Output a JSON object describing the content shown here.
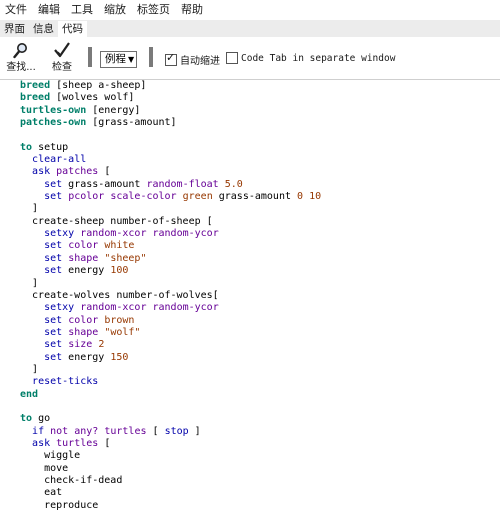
{
  "menu": [
    "文件",
    "编辑",
    "工具",
    "缩放",
    "标签页",
    "帮助"
  ],
  "tabs": [
    {
      "label": "界面",
      "active": false
    },
    {
      "label": "信息",
      "active": false
    },
    {
      "label": "代码",
      "active": true
    }
  ],
  "toolbar": {
    "find_label": "查找...",
    "check_label": "检查",
    "procedures_label": "例程",
    "auto_indent_label": "自动缩进",
    "auto_indent_checked": true,
    "separate_window_label": "Code Tab in separate window",
    "separate_window_checked": false
  },
  "colors": {
    "keyword": "#007f69",
    "command": "#0000aa",
    "reporter": "#660096",
    "constant": "#963700"
  },
  "code_lines": [
    [
      {
        "t": "breed",
        "c": "kw"
      },
      {
        "t": " [sheep a-sheep]"
      }
    ],
    [
      {
        "t": "breed",
        "c": "kw"
      },
      {
        "t": " [wolves wolf]"
      }
    ],
    [
      {
        "t": "turtles-own",
        "c": "kw"
      },
      {
        "t": " [energy]"
      }
    ],
    [
      {
        "t": "patches-own",
        "c": "kw"
      },
      {
        "t": " [grass-amount]"
      }
    ],
    [],
    [
      {
        "t": "to",
        "c": "kw"
      },
      {
        "t": " setup"
      }
    ],
    [
      {
        "t": "  "
      },
      {
        "t": "clear-all",
        "c": "cmd"
      }
    ],
    [
      {
        "t": "  "
      },
      {
        "t": "ask",
        "c": "cmd"
      },
      {
        "t": " "
      },
      {
        "t": "patches",
        "c": "rep"
      },
      {
        "t": " ["
      }
    ],
    [
      {
        "t": "    "
      },
      {
        "t": "set",
        "c": "cmd"
      },
      {
        "t": " grass-amount "
      },
      {
        "t": "random-float",
        "c": "rep"
      },
      {
        "t": " "
      },
      {
        "t": "5.0",
        "c": "con"
      }
    ],
    [
      {
        "t": "    "
      },
      {
        "t": "set",
        "c": "cmd"
      },
      {
        "t": " "
      },
      {
        "t": "pcolor",
        "c": "rep"
      },
      {
        "t": " "
      },
      {
        "t": "scale-color",
        "c": "rep"
      },
      {
        "t": " "
      },
      {
        "t": "green",
        "c": "con"
      },
      {
        "t": " grass-amount "
      },
      {
        "t": "0",
        "c": "con"
      },
      {
        "t": " "
      },
      {
        "t": "10",
        "c": "con"
      }
    ],
    [
      {
        "t": "  ]"
      }
    ],
    [
      {
        "t": "  create-sheep number-of-sheep ["
      }
    ],
    [
      {
        "t": "    "
      },
      {
        "t": "setxy",
        "c": "cmd"
      },
      {
        "t": " "
      },
      {
        "t": "random-xcor",
        "c": "rep"
      },
      {
        "t": " "
      },
      {
        "t": "random-ycor",
        "c": "rep"
      }
    ],
    [
      {
        "t": "    "
      },
      {
        "t": "set",
        "c": "cmd"
      },
      {
        "t": " "
      },
      {
        "t": "color",
        "c": "rep"
      },
      {
        "t": " "
      },
      {
        "t": "white",
        "c": "con"
      }
    ],
    [
      {
        "t": "    "
      },
      {
        "t": "set",
        "c": "cmd"
      },
      {
        "t": " "
      },
      {
        "t": "shape",
        "c": "rep"
      },
      {
        "t": " "
      },
      {
        "t": "\"sheep\"",
        "c": "con"
      }
    ],
    [
      {
        "t": "    "
      },
      {
        "t": "set",
        "c": "cmd"
      },
      {
        "t": " energy "
      },
      {
        "t": "100",
        "c": "con"
      }
    ],
    [
      {
        "t": "  ]"
      }
    ],
    [
      {
        "t": "  create-wolves number-of-wolves["
      }
    ],
    [
      {
        "t": "    "
      },
      {
        "t": "setxy",
        "c": "cmd"
      },
      {
        "t": " "
      },
      {
        "t": "random-xcor",
        "c": "rep"
      },
      {
        "t": " "
      },
      {
        "t": "random-ycor",
        "c": "rep"
      }
    ],
    [
      {
        "t": "    "
      },
      {
        "t": "set",
        "c": "cmd"
      },
      {
        "t": " "
      },
      {
        "t": "color",
        "c": "rep"
      },
      {
        "t": " "
      },
      {
        "t": "brown",
        "c": "con"
      }
    ],
    [
      {
        "t": "    "
      },
      {
        "t": "set",
        "c": "cmd"
      },
      {
        "t": " "
      },
      {
        "t": "shape",
        "c": "rep"
      },
      {
        "t": " "
      },
      {
        "t": "\"wolf\"",
        "c": "con"
      }
    ],
    [
      {
        "t": "    "
      },
      {
        "t": "set",
        "c": "cmd"
      },
      {
        "t": " "
      },
      {
        "t": "size",
        "c": "rep"
      },
      {
        "t": " "
      },
      {
        "t": "2",
        "c": "con"
      }
    ],
    [
      {
        "t": "    "
      },
      {
        "t": "set",
        "c": "cmd"
      },
      {
        "t": " energy "
      },
      {
        "t": "150",
        "c": "con"
      }
    ],
    [
      {
        "t": "  ]"
      }
    ],
    [
      {
        "t": "  "
      },
      {
        "t": "reset-ticks",
        "c": "cmd"
      }
    ],
    [
      {
        "t": "end",
        "c": "kw"
      }
    ],
    [],
    [
      {
        "t": "to",
        "c": "kw"
      },
      {
        "t": " go"
      }
    ],
    [
      {
        "t": "  "
      },
      {
        "t": "if",
        "c": "cmd"
      },
      {
        "t": " "
      },
      {
        "t": "not",
        "c": "rep"
      },
      {
        "t": " "
      },
      {
        "t": "any?",
        "c": "rep"
      },
      {
        "t": " "
      },
      {
        "t": "turtles",
        "c": "rep"
      },
      {
        "t": " [ "
      },
      {
        "t": "stop",
        "c": "cmd"
      },
      {
        "t": " ]"
      }
    ],
    [
      {
        "t": "  "
      },
      {
        "t": "ask",
        "c": "cmd"
      },
      {
        "t": " "
      },
      {
        "t": "turtles",
        "c": "rep"
      },
      {
        "t": " ["
      }
    ],
    [
      {
        "t": "    wiggle"
      }
    ],
    [
      {
        "t": "    move"
      }
    ],
    [
      {
        "t": "    check-if-dead"
      }
    ],
    [
      {
        "t": "    eat"
      }
    ],
    [
      {
        "t": "    reproduce"
      }
    ]
  ]
}
